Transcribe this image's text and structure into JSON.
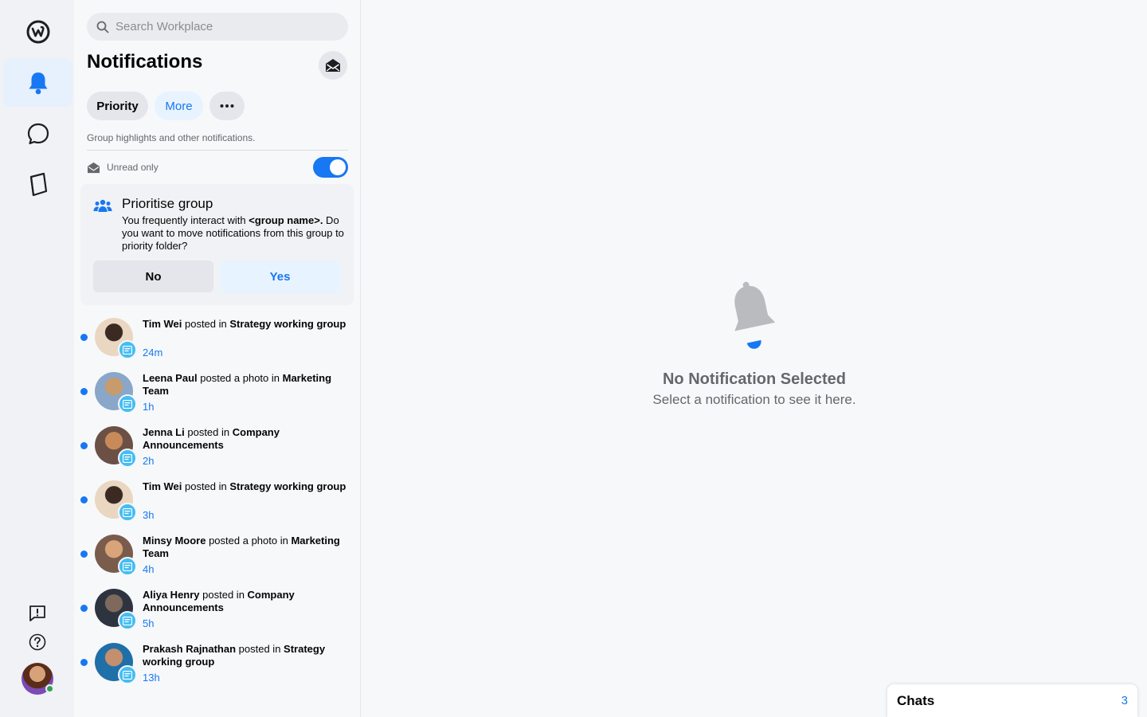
{
  "search": {
    "placeholder": "Search Workplace"
  },
  "header": {
    "title": "Notifications"
  },
  "tabs": {
    "priority": "Priority",
    "more": "More"
  },
  "subtitle": "Group highlights and other notifications.",
  "unread_filter": {
    "label": "Unread only",
    "enabled": true
  },
  "suggestion": {
    "title": "Prioritise group",
    "body_prefix": "You frequently interact with ",
    "body_group": "<group name>.",
    "body_suffix": " Do you want to move notifications from this group to priority folder?",
    "no_label": "No",
    "yes_label": "Yes"
  },
  "notifications": [
    {
      "actor": "Tim Wei",
      "verb": " posted in ",
      "target": "Strategy working group",
      "time": "24m"
    },
    {
      "actor": "Leena Paul",
      "verb": " posted a photo in ",
      "target": "Marketing Team",
      "time": "1h"
    },
    {
      "actor": "Jenna Li",
      "verb": " posted in ",
      "target": "Company Announcements",
      "time": "2h"
    },
    {
      "actor": "Tim Wei",
      "verb": " posted in ",
      "target": "Strategy working group",
      "time": "3h"
    },
    {
      "actor": "Minsy Moore",
      "verb": " posted a photo in ",
      "target": "Marketing Team",
      "time": "4h"
    },
    {
      "actor": "Aliya Henry",
      "verb": " posted in ",
      "target": "Company Announcements",
      "time": "5h"
    },
    {
      "actor": "Prakash Rajnathan",
      "verb": " posted in ",
      "target": "Strategy working group",
      "time": "13h"
    }
  ],
  "empty_state": {
    "title": "No Notification Selected",
    "subtitle": "Select a notification to see it here."
  },
  "chats": {
    "label": "Chats",
    "count": "3"
  },
  "colors": {
    "accent": "#1877f2",
    "badge": "#45bdf3",
    "active_rail": "#e7f0fd"
  },
  "icons": [
    "workplace-logo-icon",
    "bell-icon",
    "chat-bubble-icon",
    "book-icon",
    "feedback-icon",
    "help-icon",
    "search-icon",
    "envelope-open-icon",
    "group-icon",
    "post-icon"
  ]
}
